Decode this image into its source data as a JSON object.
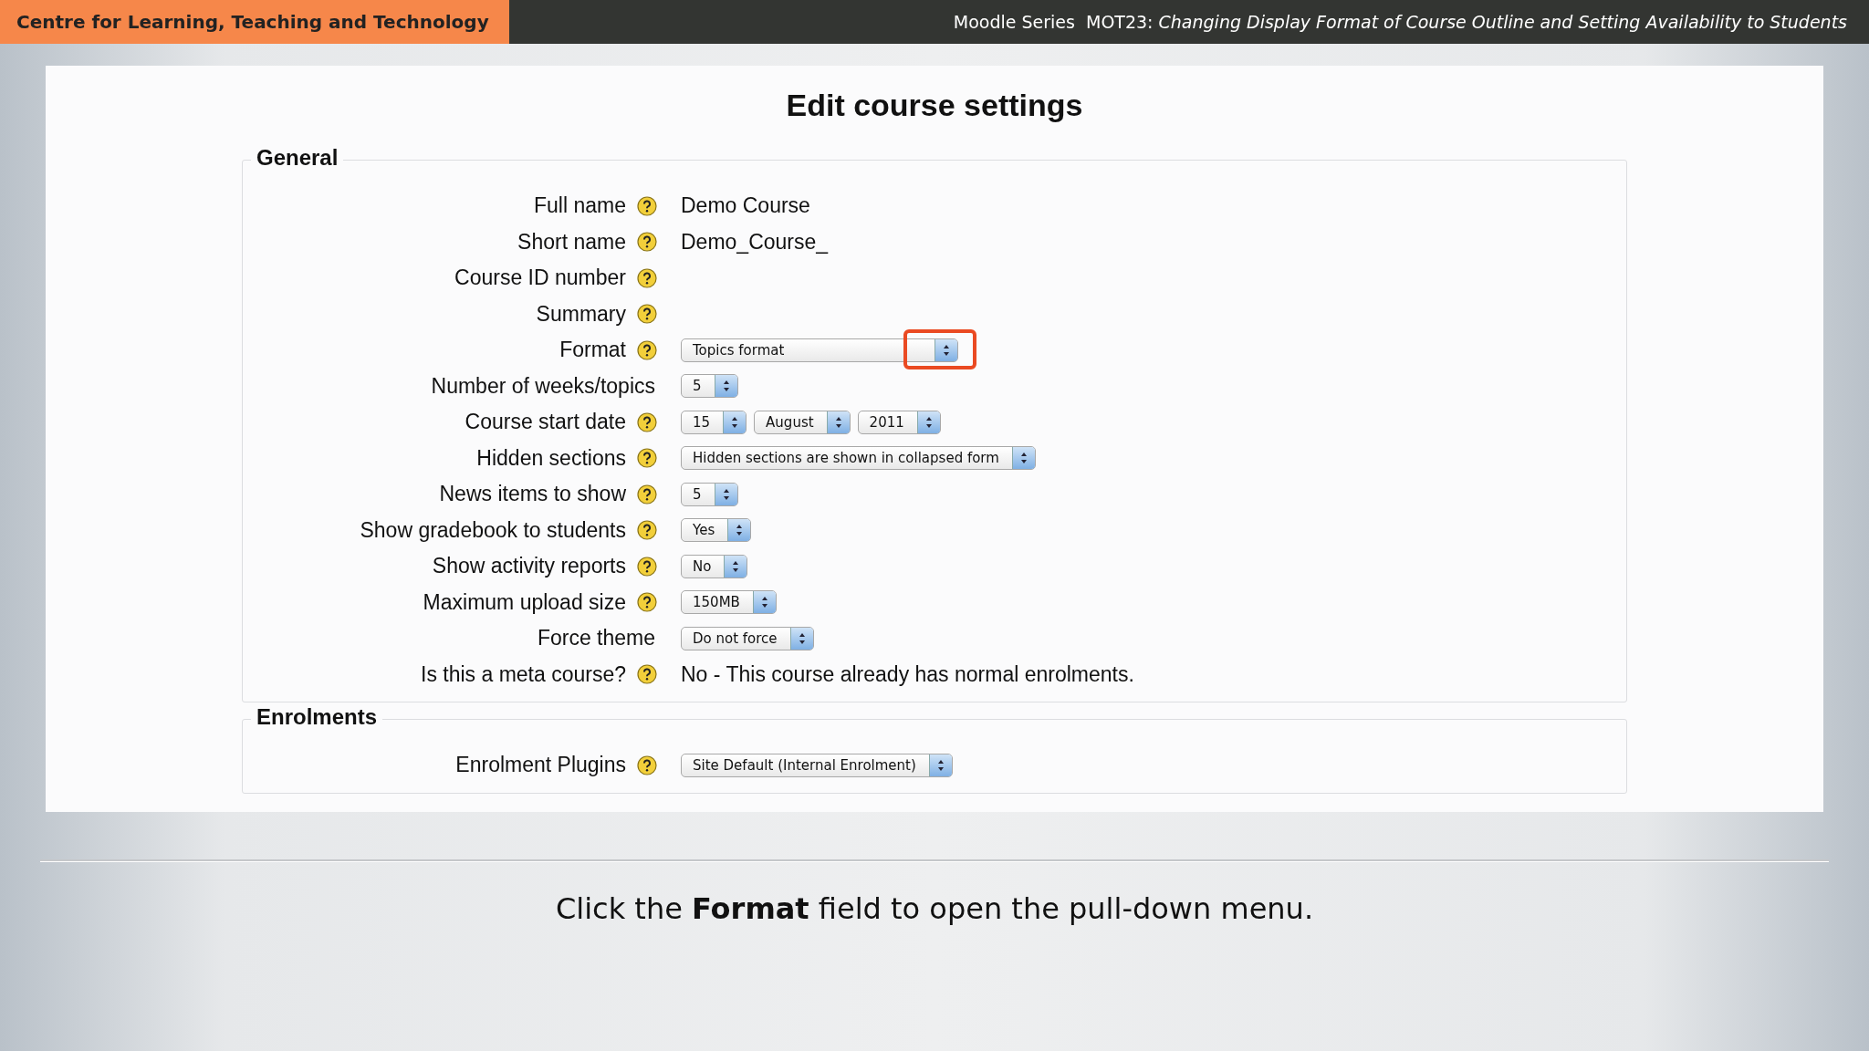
{
  "header": {
    "organization": "Centre for Learning, Teaching and Technology",
    "series": "Moodle Series  MOT23: *Changing Display Format of Course Outline and Setting Availability to Students*"
  },
  "page": {
    "title": "Edit course settings",
    "sections": [
      {
        "legend": "General",
        "rows": [
          {
            "label": "Full name",
            "help": true,
            "kind": "text",
            "value": "Demo Course"
          },
          {
            "label": "Short name",
            "help": true,
            "kind": "text",
            "value": "Demo_Course_"
          },
          {
            "label": "Course ID number",
            "help": true,
            "kind": "empty"
          },
          {
            "label": "Summary",
            "help": true,
            "kind": "empty"
          },
          {
            "label": "Format",
            "help": true,
            "kind": "select",
            "selects": [
              {
                "value": "Topics format",
                "highlighted": true
              }
            ]
          },
          {
            "label": "Number of weeks/topics",
            "help": false,
            "kind": "select",
            "selects": [
              {
                "value": "5",
                "highlighted": false
              }
            ]
          },
          {
            "label": "Course start date",
            "help": true,
            "kind": "select",
            "selects": [
              {
                "value": "15",
                "highlighted": false
              },
              {
                "value": "August",
                "highlighted": false
              },
              {
                "value": "2011",
                "highlighted": false
              }
            ]
          },
          {
            "label": "Hidden sections",
            "help": true,
            "kind": "select",
            "selects": [
              {
                "value": "Hidden sections are shown in collapsed form",
                "highlighted": false
              }
            ]
          },
          {
            "label": "News items to show",
            "help": true,
            "kind": "select",
            "selects": [
              {
                "value": "5",
                "highlighted": false
              }
            ]
          },
          {
            "label": "Show gradebook to students",
            "help": true,
            "kind": "select",
            "selects": [
              {
                "value": "Yes",
                "highlighted": false
              }
            ]
          },
          {
            "label": "Show activity reports",
            "help": true,
            "kind": "select",
            "selects": [
              {
                "value": "No",
                "highlighted": false
              }
            ]
          },
          {
            "label": "Maximum upload size",
            "help": true,
            "kind": "select",
            "selects": [
              {
                "value": "150MB",
                "highlighted": false
              }
            ]
          },
          {
            "label": "Force theme",
            "help": false,
            "kind": "select",
            "selects": [
              {
                "value": "Do not force",
                "highlighted": false
              }
            ]
          },
          {
            "label": "Is this a meta course?",
            "help": true,
            "kind": "text",
            "value": "No - This course already has normal enrolments."
          }
        ]
      },
      {
        "legend": "Enrolments",
        "rows": [
          {
            "label": "Enrolment Plugins",
            "help": true,
            "kind": "select",
            "selects": [
              {
                "value": "Site Default (Internal Enrolment)",
                "highlighted": false
              }
            ]
          }
        ]
      }
    ]
  },
  "caption": "Click the **Format** field to open the pull-down menu."
}
